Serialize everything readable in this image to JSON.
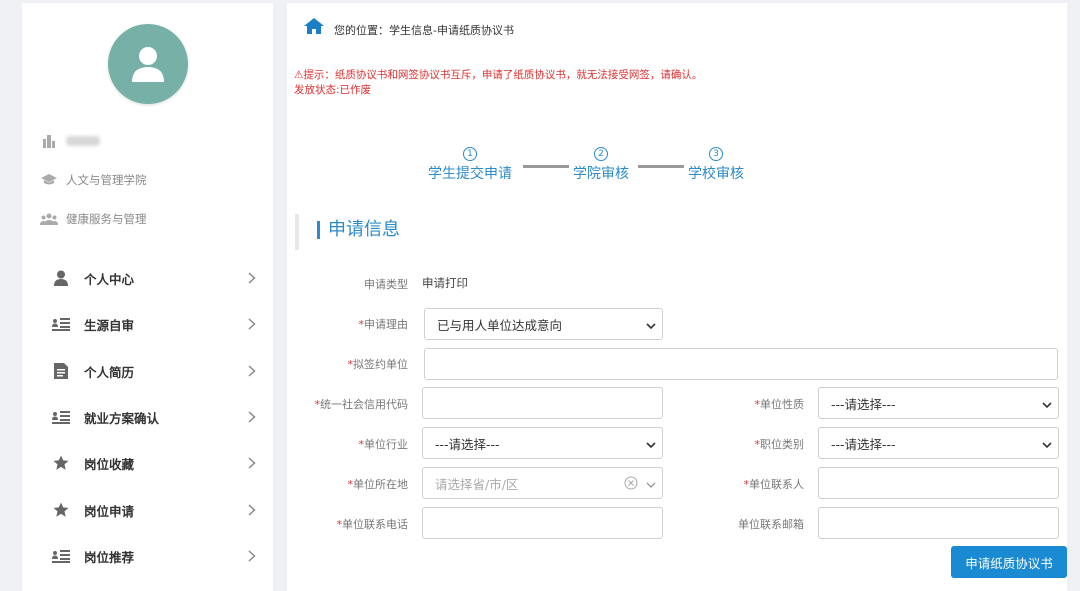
{
  "sidebar": {
    "school_name": "",
    "college": "人文与管理学院",
    "major": "健康服务与管理",
    "menu": [
      {
        "label": "个人中心",
        "icon": "user-icon"
      },
      {
        "label": "生源自审",
        "icon": "list-card-icon"
      },
      {
        "label": "个人简历",
        "icon": "document-icon"
      },
      {
        "label": "就业方案确认",
        "icon": "list-card-icon"
      },
      {
        "label": "岗位收藏",
        "icon": "star-icon"
      },
      {
        "label": "岗位申请",
        "icon": "star-icon"
      },
      {
        "label": "岗位推荐",
        "icon": "list-card-icon"
      }
    ]
  },
  "breadcrumb": {
    "text": "您的位置：学生信息-申请纸质协议书"
  },
  "notice": {
    "tip": "⚠提示：纸质协议书和网签协议书互斥，申请了纸质协议书，就无法接受网签，请确认。",
    "status": "发放状态:已作废"
  },
  "steps": [
    {
      "num": "1",
      "label": "学生提交申请"
    },
    {
      "num": "2",
      "label": "学院审核"
    },
    {
      "num": "3",
      "label": "学校审核"
    }
  ],
  "section": {
    "title": "申请信息"
  },
  "form": {
    "apply_type_label": "申请类型",
    "apply_type_value": "申请打印",
    "reason_label": "申请理由",
    "reason_value": "已与用人单位达成意向",
    "unit_label": "拟签约单位",
    "unit_value": "",
    "credit_code_label": "统一社会信用代码",
    "credit_code_value": "",
    "nature_label": "单位性质",
    "nature_value": "---请选择---",
    "industry_label": "单位行业",
    "industry_value": "---请选择---",
    "job_type_label": "职位类别",
    "job_type_value": "---请选择---",
    "location_label": "单位所在地",
    "location_placeholder": "请选择省/市/区",
    "contact_label": "单位联系人",
    "contact_value": "",
    "phone_label": "单位联系电话",
    "phone_value": "",
    "email_label": "单位联系邮箱",
    "email_value": "",
    "submit_label": "申请纸质协议书"
  },
  "colors": {
    "accent": "#1a8ad3",
    "avatar": "#77b0a6",
    "warning": "#e03030"
  }
}
